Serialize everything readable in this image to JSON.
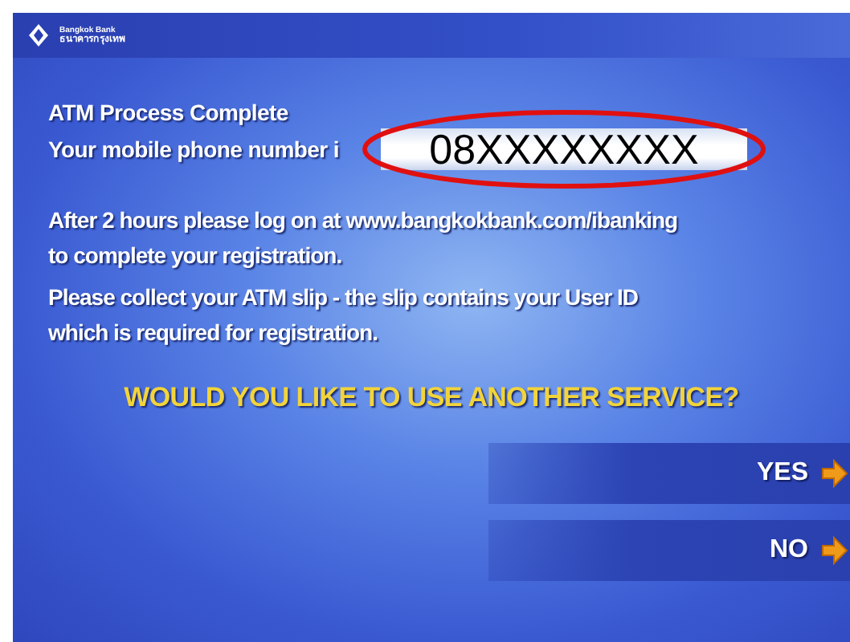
{
  "header": {
    "logo_name": "Bangkok Bank",
    "logo_name_thai": "ธนาคารกรุงเทพ"
  },
  "title": "ATM Process Complete",
  "phone": {
    "label": "Your mobile phone number i",
    "value": "08XXXXXXXX"
  },
  "messages": [
    "After 2 hours please log on at www.bangkokbank.com/ibanking to complete your registration.",
    "Please collect your ATM slip - the slip contains your User ID which is required for registration."
  ],
  "question": "WOULD YOU LIKE TO USE ANOTHER SERVICE?",
  "options": [
    {
      "label": "YES"
    },
    {
      "label": "NO"
    }
  ]
}
